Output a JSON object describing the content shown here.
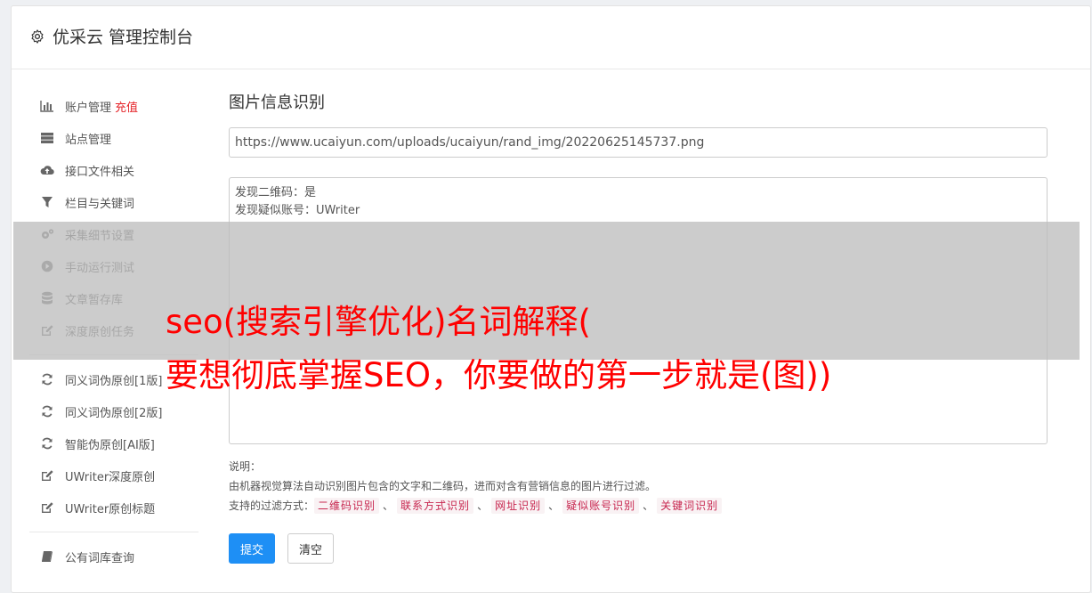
{
  "header": {
    "title": "优采云 管理控制台",
    "icon": "gear-icon"
  },
  "sidebar": {
    "group1": [
      {
        "label": "账户管理",
        "badge": "充值",
        "icon": "bar-chart-icon"
      },
      {
        "label": "站点管理",
        "icon": "server-icon"
      },
      {
        "label": "接口文件相关",
        "icon": "cloud-upload-icon"
      },
      {
        "label": "栏目与关键词",
        "icon": "filter-icon"
      },
      {
        "label": "采集细节设置",
        "icon": "gears-icon"
      },
      {
        "label": "手动运行测试",
        "icon": "play-circle-icon"
      },
      {
        "label": "文章暂存库",
        "icon": "database-icon"
      },
      {
        "label": "深度原创任务",
        "icon": "edit-icon"
      }
    ],
    "group2": [
      {
        "label": "同义词伪原创[1版]",
        "icon": "refresh-icon"
      },
      {
        "label": "同义词伪原创[2版]",
        "icon": "refresh-icon"
      },
      {
        "label": "智能伪原创[AI版]",
        "icon": "refresh-icon"
      },
      {
        "label": "UWriter深度原创",
        "icon": "edit-icon"
      },
      {
        "label": "UWriter原创标题",
        "icon": "edit-icon"
      }
    ],
    "group3": [
      {
        "label": "公有词库查询",
        "icon": "book-icon"
      }
    ]
  },
  "main": {
    "heading": "图片信息识别",
    "url_value": "https://www.ucaiyun.com/uploads/ucaiyun/rand_img/20220625145737.png",
    "result_lines": [
      "发现二维码：是",
      "发现疑似账号：UWriter"
    ],
    "notes_title": "说明：",
    "notes_desc": "由机器视觉算法自动识别图片包含的文字和二维码，进而对含有营销信息的图片进行过滤。",
    "filter_label": "支持的过滤方式：",
    "filters": [
      "二维码识别",
      "联系方式识别",
      "网址识别",
      "疑似账号识别",
      "关键词识别"
    ],
    "filter_sep": "、",
    "submit_label": "提交",
    "clear_label": "清空"
  },
  "overlay": {
    "line1": "seo(搜索引擎优化)名词解释(",
    "line2": "要想彻底掌握SEO，你要做的第一步就是(图))"
  },
  "colors": {
    "accent": "#1e8ff5",
    "badge_red": "#e5252a",
    "tag_text": "#c7254e",
    "overlay_text": "#ff0000"
  }
}
